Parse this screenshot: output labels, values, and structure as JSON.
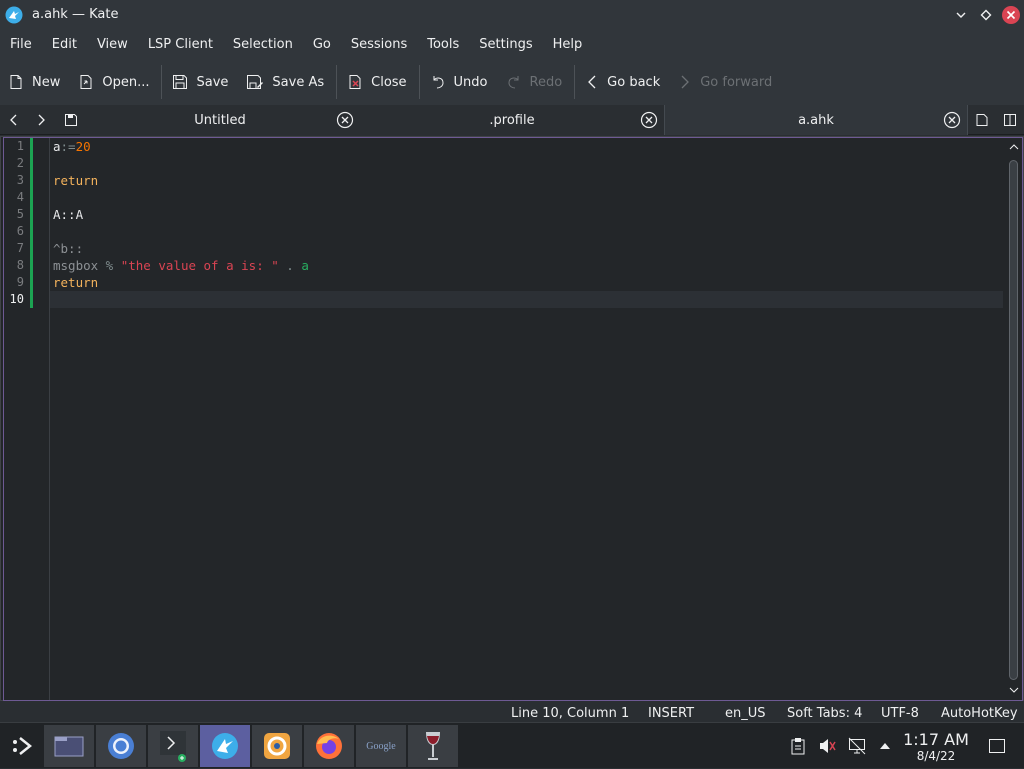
{
  "window": {
    "title": "a.ahk — Kate"
  },
  "menu": [
    "File",
    "Edit",
    "View",
    "LSP Client",
    "Selection",
    "Go",
    "Sessions",
    "Tools",
    "Settings",
    "Help"
  ],
  "toolbar": {
    "new": "New",
    "open": "Open...",
    "save": "Save",
    "save_as": "Save As",
    "close": "Close",
    "undo": "Undo",
    "redo": "Redo",
    "go_back": "Go back",
    "go_forward": "Go forward"
  },
  "tabs": [
    {
      "label": "Untitled",
      "active": false
    },
    {
      "label": ".profile",
      "active": false
    },
    {
      "label": "a.ahk",
      "active": true
    }
  ],
  "editor": {
    "line_numbers": [
      "1",
      "2",
      "3",
      "4",
      "5",
      "6",
      "7",
      "8",
      "9",
      "10"
    ],
    "current_line": 10,
    "lines": [
      [
        {
          "t": "a",
          "c": "def"
        },
        {
          "t": ":=",
          "c": "op"
        },
        {
          "t": "20",
          "c": "num"
        }
      ],
      [],
      [
        {
          "t": "return",
          "c": "kw"
        }
      ],
      [],
      [
        {
          "t": "A::A",
          "c": "def"
        }
      ],
      [],
      [
        {
          "t": "^b::",
          "c": "dim"
        }
      ],
      [
        {
          "t": "msgbox",
          "c": "dim"
        },
        {
          "t": " % ",
          "c": "op"
        },
        {
          "t": "\"the value of a is: \"",
          "c": "str"
        },
        {
          "t": " . ",
          "c": "op"
        },
        {
          "t": "a",
          "c": "var"
        }
      ],
      [
        {
          "t": "return",
          "c": "kw"
        }
      ],
      []
    ]
  },
  "status": {
    "position": "Line 10, Column 1",
    "mode": "INSERT",
    "language": "en_US",
    "indent": "Soft Tabs: 4",
    "encoding": "UTF-8",
    "syntax": "AutoHotKey"
  },
  "taskbar": {
    "apps": [
      "launcher-icon",
      "file-manager-icon",
      "chromium-icon",
      "terminal-icon",
      "kate-icon",
      "blender-icon",
      "firefox-icon",
      "google-icon",
      "wine-icon"
    ],
    "google_text": "Google",
    "clock_time": "1:17 AM",
    "clock_date": "8/4/22"
  },
  "colors": {
    "accent": "#7e6aa8",
    "modified_marker": "#1ca352",
    "keyword": "#f3b25c",
    "number": "#f67400",
    "string": "#da4453",
    "variable": "#27ae60",
    "window_close": "#da4453"
  }
}
